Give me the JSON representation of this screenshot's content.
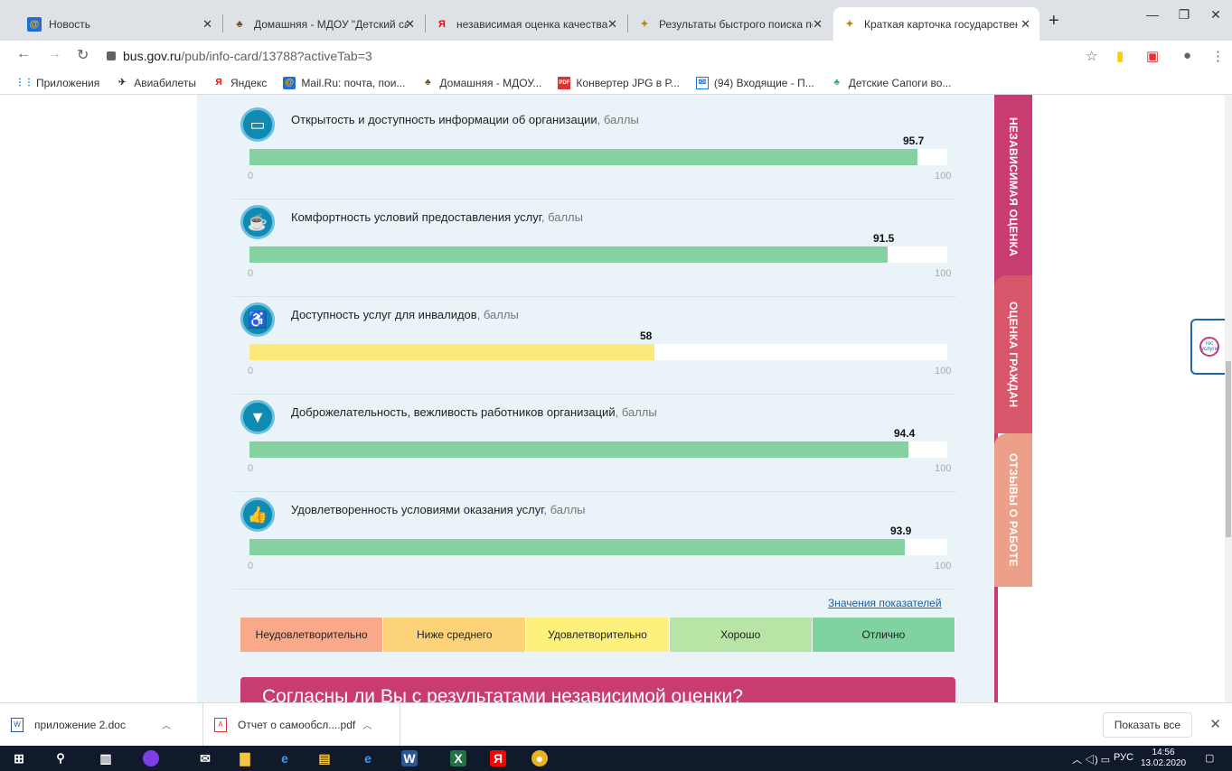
{
  "browser": {
    "tabs": [
      {
        "title": "Новость",
        "icon": "mail-ru-icon",
        "active": false
      },
      {
        "title": "Домашняя - МДОУ \"Детский са",
        "icon": "kindergarten-icon",
        "active": false
      },
      {
        "title": "независимая оценка качества о",
        "icon": "yandex-icon",
        "active": false
      },
      {
        "title": "Результаты быстрого поиска по",
        "icon": "coat-of-arms-icon",
        "active": false
      },
      {
        "title": "Краткая карточка государствен",
        "icon": "coat-of-arms-icon",
        "active": true
      }
    ],
    "url_host": "bus.gov.ru",
    "url_path": "/pub/info-card/13788?activeTab=3",
    "bookmarks": [
      {
        "label": "Приложения",
        "icon": "apps-grid-icon"
      },
      {
        "label": "Авиабилеты",
        "icon": "plane-icon"
      },
      {
        "label": "Яндекс",
        "icon": "yandex-icon"
      },
      {
        "label": "Mail.Ru: почта, пои...",
        "icon": "mail-ru-icon"
      },
      {
        "label": "Домашняя - МДОУ...",
        "icon": "kindergarten-icon"
      },
      {
        "label": "Конвертер JPG в P...",
        "icon": "pdf-icon"
      },
      {
        "label": "(94) Входящие - П...",
        "icon": "inbox-icon"
      },
      {
        "label": "Детские Сапоги во...",
        "icon": "shoe-icon"
      }
    ]
  },
  "metrics": [
    {
      "label": "Открытость и доступность информации об организации",
      "unit": ", баллы",
      "value": "95.7",
      "fraction": 0.957,
      "color": "#86d1a2",
      "icon": "inbox-tray-icon",
      "glyph": "▭",
      "min": "0",
      "max": "100"
    },
    {
      "label": "Комфортность условий предоставления услуг",
      "unit": ", баллы",
      "value": "91.5",
      "fraction": 0.915,
      "color": "#86d1a2",
      "icon": "coffee-cup-icon",
      "glyph": "☕",
      "min": "0",
      "max": "100"
    },
    {
      "label": "Доступность услуг для инвалидов",
      "unit": ", баллы",
      "value": "58",
      "fraction": 0.58,
      "color": "#fce97a",
      "icon": "wheelchair-icon",
      "glyph": "♿",
      "min": "0",
      "max": "100"
    },
    {
      "label": "Доброжелательность, вежливость работников организаций",
      "unit": ", баллы",
      "value": "94.4",
      "fraction": 0.944,
      "color": "#86d1a2",
      "icon": "necktie-icon",
      "glyph": "▼",
      "min": "0",
      "max": "100"
    },
    {
      "label": "Удовлетворенность условиями оказания услуг",
      "unit": ", баллы",
      "value": "93.9",
      "fraction": 0.939,
      "color": "#86d1a2",
      "icon": "thumbs-up-icon",
      "glyph": "👍",
      "min": "0",
      "max": "100"
    }
  ],
  "legend_link": "Значения показателей",
  "legend": [
    {
      "label": "Неудовлетворительно",
      "color": "#f9a98a"
    },
    {
      "label": "Ниже среднего",
      "color": "#fdd37a"
    },
    {
      "label": "Удовлетворительно",
      "color": "#fdf07c"
    },
    {
      "label": "Хорошо",
      "color": "#b8e4a6"
    },
    {
      "label": "Отлично",
      "color": "#7fd3a0"
    }
  ],
  "banner_text": "Согласны ли Вы с результатами независимой оценки?",
  "side_tabs": [
    {
      "label": "НЕЗАВИСИМАЯ ОЦЕНКА",
      "color": "#c83c71"
    },
    {
      "label": "ОЦЕНКА ГРАЖДАН",
      "color": "#d8566a"
    },
    {
      "label": "ОТЗЫВЫ О РАБОТЕ",
      "color": "#eca089"
    }
  ],
  "gosuslugi_label": "гос услуги",
  "downloads": [
    {
      "name": "приложение 2.doc",
      "icon": "word-doc-icon"
    },
    {
      "name": "Отчет о самообсл....pdf",
      "icon": "pdf-icon"
    }
  ],
  "show_all": "Показать все",
  "tray": {
    "lang": "РУС",
    "time": "14:56",
    "date": "13.02.2020"
  }
}
